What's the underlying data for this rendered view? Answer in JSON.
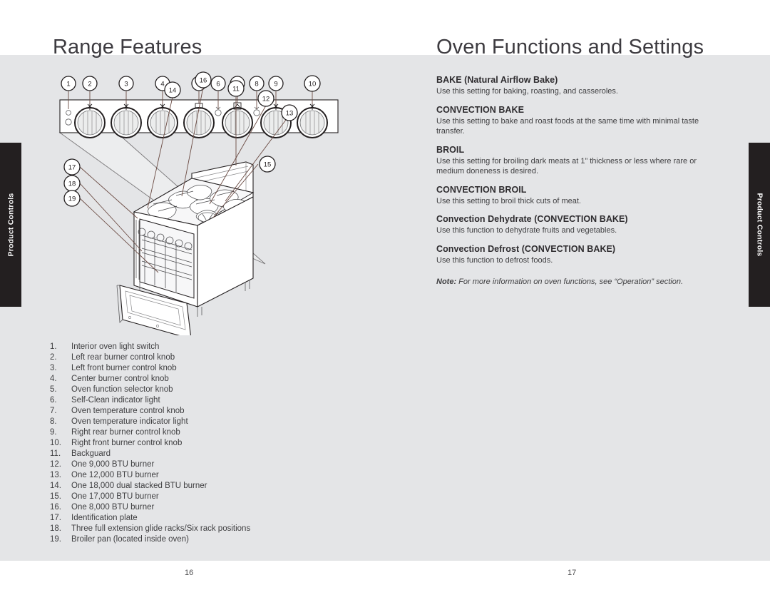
{
  "left_page": {
    "title": "Range Features",
    "page_number": "16",
    "side_tab": "Product Controls",
    "legend": [
      {
        "num": "1.",
        "text": "Interior oven light switch"
      },
      {
        "num": "2.",
        "text": "Left rear burner control knob"
      },
      {
        "num": "3.",
        "text": "Left front burner control knob"
      },
      {
        "num": "4.",
        "text": "Center burner control knob"
      },
      {
        "num": "5.",
        "text": "Oven function selector knob"
      },
      {
        "num": "6.",
        "text": "Self-Clean indicator light"
      },
      {
        "num": "7.",
        "text": "Oven temperature control knob"
      },
      {
        "num": "8.",
        "text": "Oven temperature indicator light"
      },
      {
        "num": "9.",
        "text": "Right rear burner control knob"
      },
      {
        "num": "10.",
        "text": "Right front burner control knob"
      },
      {
        "num": "11.",
        "text": "Backguard"
      },
      {
        "num": "12.",
        "text": "One 9,000 BTU burner"
      },
      {
        "num": "13.",
        "text": "One 12,000 BTU burner"
      },
      {
        "num": "14.",
        "text": "One 18,000 dual stacked BTU burner"
      },
      {
        "num": "15.",
        "text": "One 17,000 BTU burner"
      },
      {
        "num": "16.",
        "text": "One 8,000 BTU burner"
      },
      {
        "num": "17.",
        "text": "Identification plate"
      },
      {
        "num": "18.",
        "text": "Three full extension glide racks/Six rack positions"
      },
      {
        "num": "19.",
        "text": "Broiler pan (located inside oven)"
      }
    ],
    "callouts_panel": [
      "1",
      "2",
      "3",
      "4",
      "5",
      "6",
      "7",
      "8",
      "9",
      "10"
    ],
    "callouts_range": [
      "11",
      "12",
      "13",
      "14",
      "15",
      "16",
      "17",
      "18",
      "19"
    ]
  },
  "right_page": {
    "title": "Oven Functions and Settings",
    "page_number": "17",
    "side_tab": "Product Controls",
    "functions": [
      {
        "heading": "BAKE (Natural Airflow Bake)",
        "body": "Use this setting for baking, roasting, and casseroles."
      },
      {
        "heading": "CONVECTION BAKE",
        "body": "Use this setting to bake and roast foods at the same time with minimal taste transfer."
      },
      {
        "heading": "BROIL",
        "body": "Use this setting for broiling dark meats at 1” thickness or less where rare or medium doneness is desired."
      },
      {
        "heading": "CONVECTION BROIL",
        "body": "Use this setting to broil thick cuts of meat."
      },
      {
        "heading": "Convection Dehydrate (CONVECTION BAKE)",
        "body": "Use this function to dehydrate fruits and vegetables."
      },
      {
        "heading": "Convection Defrost (CONVECTION BAKE)",
        "body": "Use this function to defrost foods."
      }
    ],
    "note_label": "Note:",
    "note_text": " For more information on oven functions, see “Operation” section."
  },
  "colors": {
    "page_background": "#ffffff",
    "content_band": "#e4e5e7",
    "side_tab_background": "#231f20",
    "side_tab_text": "#ffffff",
    "title_text": "#3d3b40",
    "body_text": "#3f3f41",
    "line_art": "#231f20"
  }
}
